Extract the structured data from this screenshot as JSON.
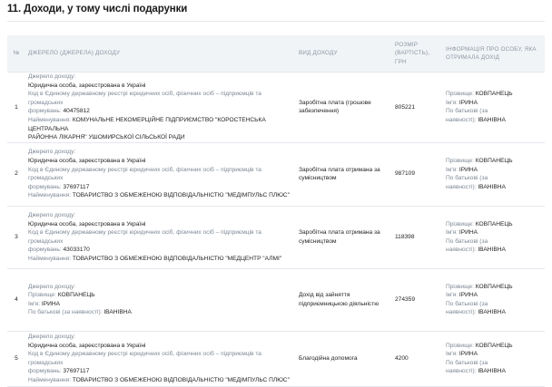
{
  "section_title": "11. Доходи, у тому числі подарунки",
  "labels": {
    "source_label": "Джерело доходу:",
    "legal_entity": "Юридична особа, зареєстрована в Україні",
    "edrpou_line1": "Код в Єдиному державному реєстрі юридичних осіб, фізичних осіб – підприємців та громадських",
    "edrpou_line2": "формувань:",
    "name_label": "Найменування:",
    "surname_label": "Прізвище:",
    "first_name_label": "Ім'я:",
    "patronymic_label": "По батькові (за наявності):",
    "patronymic_label_l1": "По батькові (за",
    "patronymic_label_l2": "наявності):"
  },
  "table": {
    "headers": {
      "num": "№",
      "source": "Джерело (джерела) доходу",
      "type": "Вид доходу",
      "amount_l1": "Розмір",
      "amount_l2": "(вартість),",
      "amount_l3": "грн",
      "person_l1": "Інформація про особу, яка",
      "person_l2": "отримала дохід"
    },
    "rows": [
      {
        "num": "1",
        "code": "40475812",
        "name_l1": "КОМУНАЛЬНЕ НЕКОМЕРЦІЙНЕ ПІДПРИЄМСТВО \"КОРОСТЕНСЬКА ЦЕНТРАЛЬНА",
        "name_l2": "РАЙОННА ЛІКАРНЯ\" УШОМИРСЬКОЇ СІЛЬСЬКОЇ РАДИ",
        "type_l1": "Заробітна плата (грошове",
        "type_l2": "забезпечення)",
        "amount": "805221",
        "surname": "КОВПАНЕЦЬ",
        "first_name": "ІРИНА",
        "patronymic": "ІВАНІВНА"
      },
      {
        "num": "2",
        "code": "37697117",
        "name_l1": "ТОВАРИСТВО З ОБМЕЖЕНОЮ ВІДПОВІДАЛЬНІСТЮ \"МЕДІМПУЛЬС ПЛЮС\"",
        "type_l1": "Заробітна плата отримана за",
        "type_l2": "сумісництвом",
        "amount": "987109",
        "surname": "КОВПАНЕЦЬ",
        "first_name": "ІРИНА",
        "patronymic": "ІВАНІВНА"
      },
      {
        "num": "3",
        "code": "43033170",
        "name_l1": "ТОВАРИСТВО З ОБМЕЖЕНОЮ ВІДПОВІДАЛЬНІСТЮ \"МЕДЦЕНТР \"АЛМІ\"",
        "type_l1": "Заробітна плата отримана за",
        "type_l2": "сумісництвом",
        "amount": "118398",
        "surname": "КОВПАНЕЦЬ",
        "first_name": "ІРИНА",
        "patronymic": "ІВАНІВНА"
      },
      {
        "num": "4",
        "src_surname": "КОВПАНЕЦЬ",
        "src_first_name": "ІРИНА",
        "src_patronymic": "ІВАНІВНА",
        "type_l1": "Дохід від зайняття",
        "type_l2": "підприємницькою діяльністю",
        "amount": "274359",
        "surname": "КОВПАНЕЦЬ",
        "first_name": "ІРИНА",
        "patronymic": "ІВАНІВНА"
      },
      {
        "num": "5",
        "code": "37697117",
        "name_l1": "ТОВАРИСТВО З ОБМЕЖЕНОЮ ВІДПОВІДАЛЬНІСТЮ \"МЕДІМПУЛЬС ПЛЮС\"",
        "type_l1": "Благодійна допомога",
        "amount": "4200",
        "surname": "КОВПАНЕЦЬ",
        "first_name": "ІРИНА",
        "patronymic": "ІВАНІВНА"
      }
    ]
  }
}
